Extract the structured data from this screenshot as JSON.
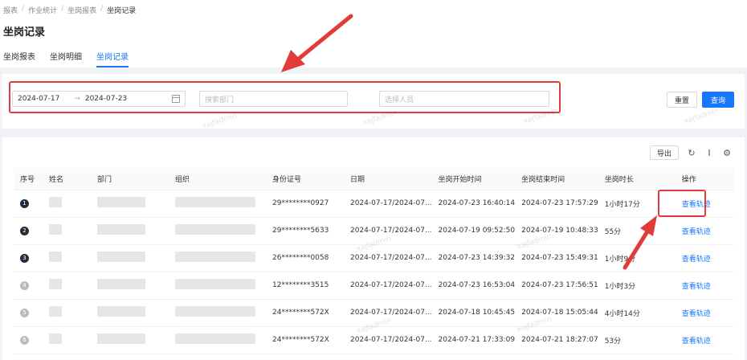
{
  "breadcrumb": [
    "报表",
    "作业统计",
    "坐岗报表",
    "坐岗记录"
  ],
  "page_title": "坐岗记录",
  "tabs": [
    "坐岗报表",
    "坐岗明细",
    "坐岗记录"
  ],
  "filters": {
    "date_start": "2024-07-17",
    "date_end": "2024-07-23",
    "dept_placeholder": "搜索部门",
    "person_placeholder": "选择人员",
    "reset_label": "重置",
    "search_label": "查询"
  },
  "toolbar": {
    "export_label": "导出"
  },
  "table": {
    "columns": [
      "序号",
      "姓名",
      "部门",
      "组织",
      "身份证号",
      "日期",
      "坐岗开始时间",
      "坐岗结束时间",
      "坐岗时长",
      "操作"
    ],
    "action_label": "查看轨迹",
    "rows": [
      {
        "idx": "1",
        "id": "29********0927",
        "date": "2024-07-17/2024-07...",
        "start": "2024-07-23 16:40:14",
        "end": "2024-07-23 17:57:29",
        "duration": "1小时17分"
      },
      {
        "idx": "2",
        "id": "29********5633",
        "date": "2024-07-17/2024-07...",
        "start": "2024-07-19 09:52:50",
        "end": "2024-07-19 10:48:33",
        "duration": "55分"
      },
      {
        "idx": "3",
        "id": "26********0058",
        "date": "2024-07-17/2024-07...",
        "start": "2024-07-23 14:39:32",
        "end": "2024-07-23 15:49:31",
        "duration": "1小时9分"
      },
      {
        "idx": "4",
        "id": "12********3515",
        "date": "2024-07-17/2024-07...",
        "start": "2024-07-23 16:53:04",
        "end": "2024-07-23 17:56:51",
        "duration": "1小时3分"
      },
      {
        "idx": "5",
        "id": "24********572X",
        "date": "2024-07-17/2024-07...",
        "start": "2024-07-18 10:45:45",
        "end": "2024-07-18 15:05:44",
        "duration": "4小时14分"
      },
      {
        "idx": "6",
        "id": "24********572X",
        "date": "2024-07-17/2024-07...",
        "start": "2024-07-21 17:33:09",
        "end": "2024-07-21 18:27:07",
        "duration": "53分"
      }
    ]
  },
  "watermark": "xajfadmin",
  "colors": {
    "primary": "#1677ff",
    "highlight": "#e23b3b"
  }
}
